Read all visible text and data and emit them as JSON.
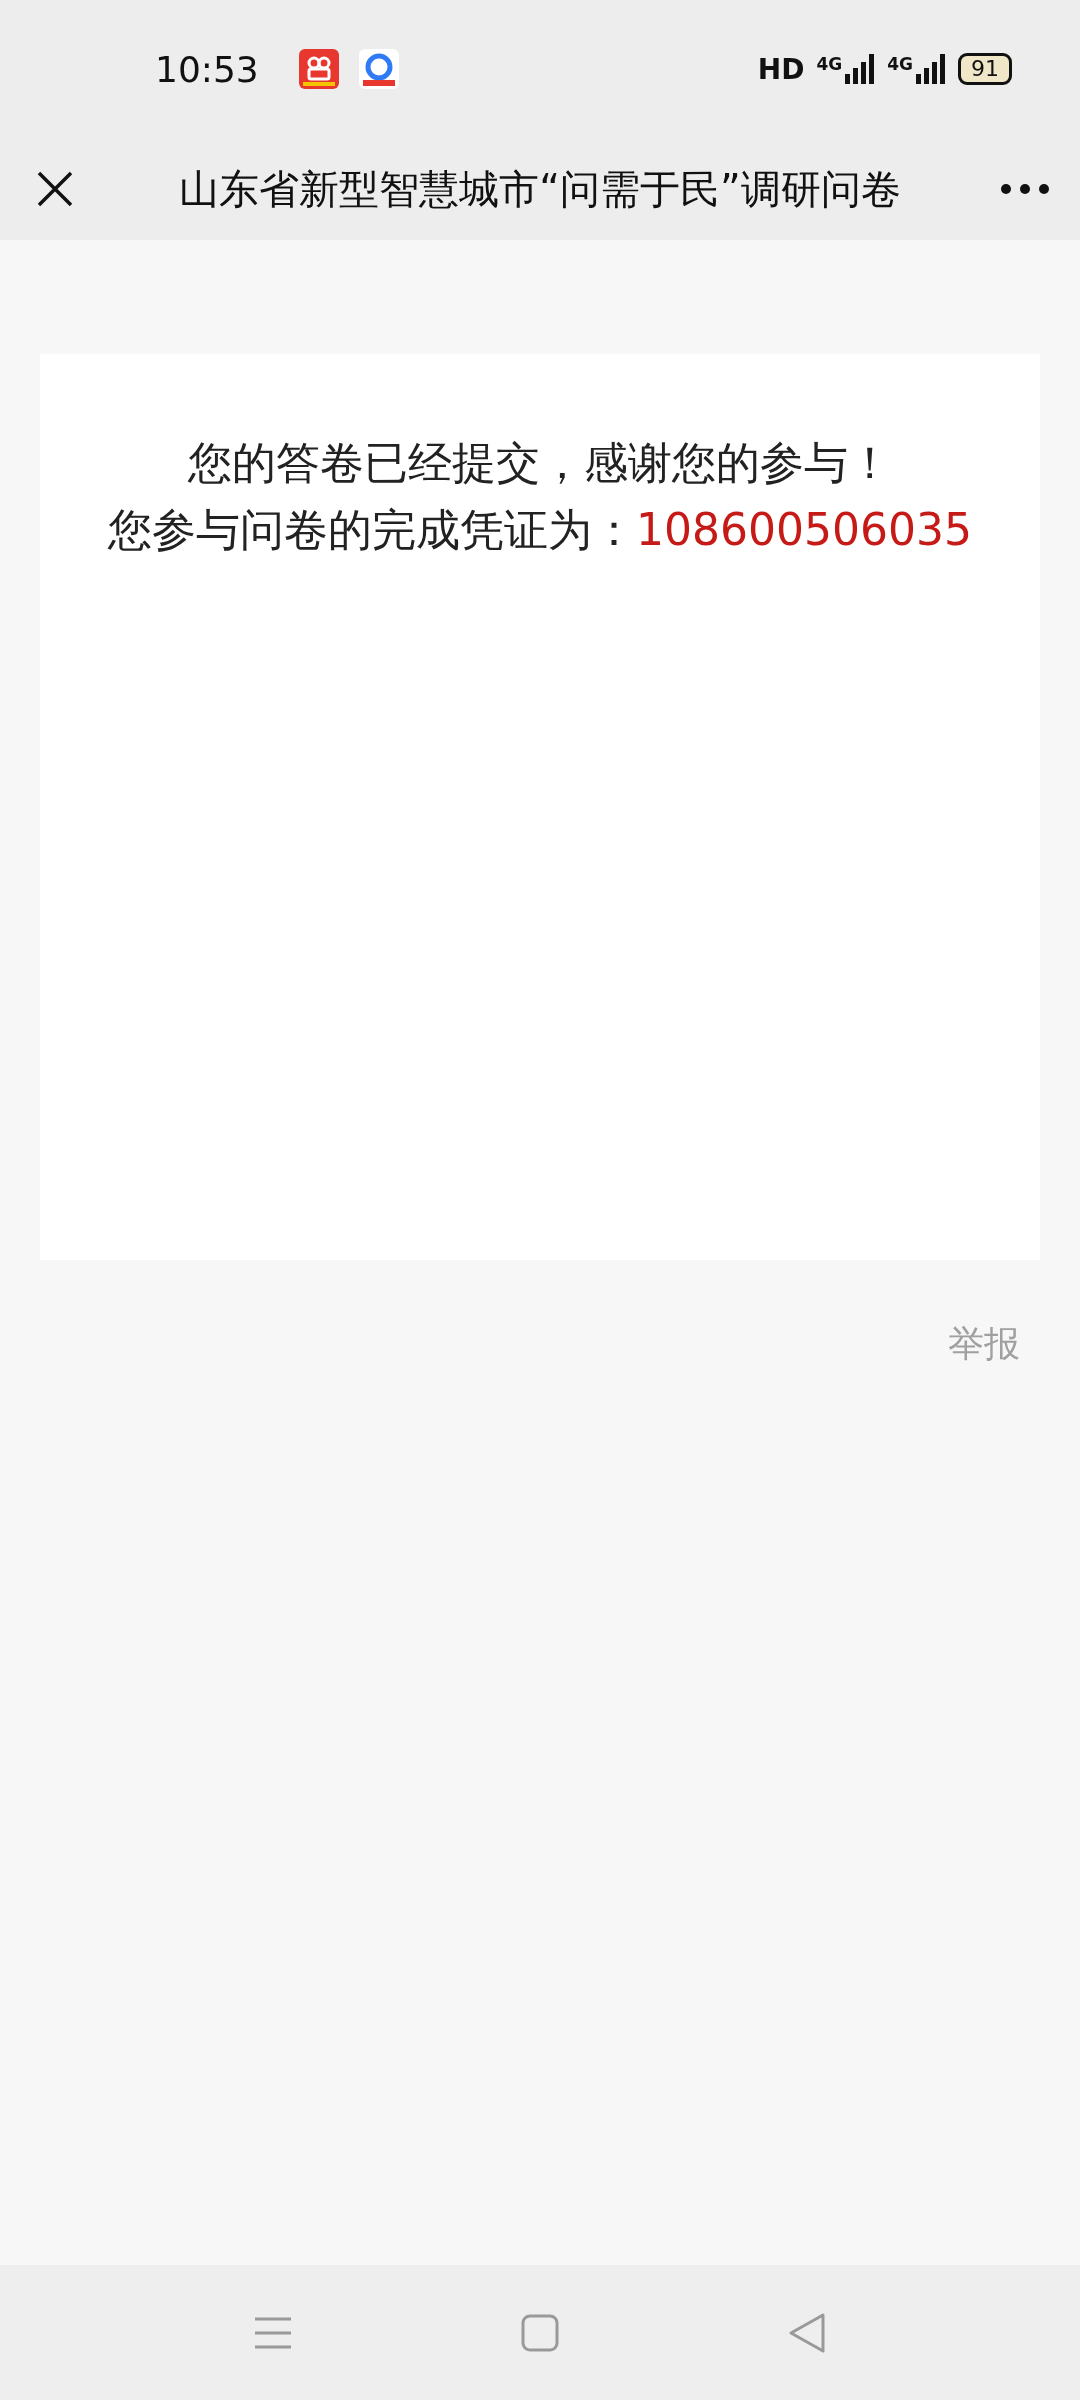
{
  "status_bar": {
    "time": "10:53",
    "network": "HD",
    "signals": [
      "4G",
      "4G"
    ],
    "battery": "91"
  },
  "title_bar": {
    "title": "山东省新型智慧城市“问需于民”调研问卷"
  },
  "result_card": {
    "message": "您的答卷已经提交，感谢您的参与！",
    "code_label": "您参与问卷的完成凭证为：",
    "code": "108600506035"
  },
  "report_link": "举报"
}
